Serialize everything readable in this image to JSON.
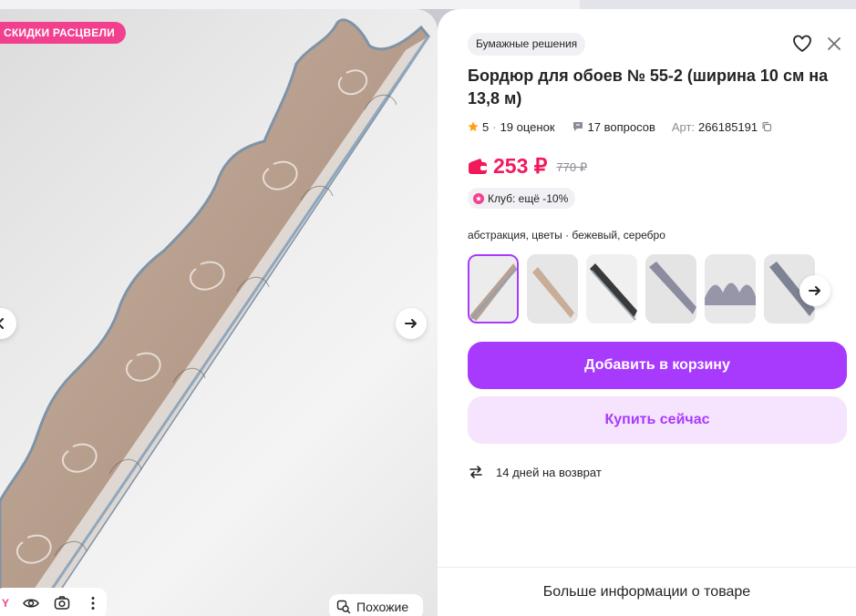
{
  "promo": {
    "badge": "СКИДКИ РАСЦВЕЛИ"
  },
  "gallery": {
    "prev_icon": "chevron-left-icon",
    "next_icon": "arrow-right-icon",
    "toolbar": {
      "brand_letter": "Y",
      "icons": [
        "eye-icon",
        "camera-search-icon",
        "more-vertical-icon"
      ]
    },
    "similar_label": "Похожие"
  },
  "product": {
    "brand": "Бумажные решения",
    "title": "Бордюр для обоев № 55-2 (ширина 10 см на 13,8 м)",
    "rating": "5",
    "reviews": "19 оценок",
    "questions": "17 вопросов",
    "article_label": "Арт:",
    "article": "266185191",
    "price_now": "253 ₽",
    "price_old": "770 ₽",
    "club_text": "Клуб: ещё -10%",
    "variant_label": "абстракция, цветы · бежевый, серебро",
    "thumbnails_count": 6,
    "active_thumbnail": 1
  },
  "actions": {
    "add_to_cart": "Добавить в корзину",
    "buy_now": "Купить сейчас"
  },
  "returns": {
    "text": "14 дней на возврат"
  },
  "more_info": "Больше информации о товаре",
  "colors": {
    "accent": "#a73afd",
    "accent_light": "#f6e3fd",
    "price": "#f2195b",
    "promo": "#f2408f",
    "star": "#ff9f0a"
  }
}
